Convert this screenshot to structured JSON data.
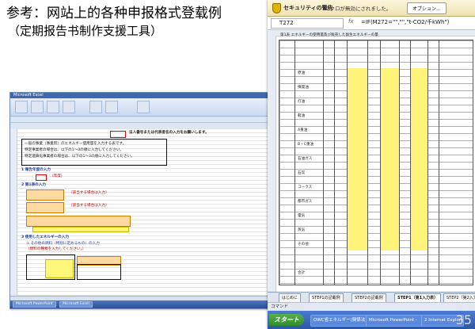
{
  "heading": {
    "line1": "参考：网站上的各种申报格式登载例",
    "line2": "（定期报告书制作支援工具）"
  },
  "left_window": {
    "sheet_notice": "法人番号または代表者名の入力をお願いします。",
    "section1": "1 報告年度の入力",
    "section2": "2 第1表の入力",
    "section3": "3 使用したエネルギーの入力",
    "section3a": "① その他の燃料（特別に定めるもの）の入力",
    "taskbar": [
      "Microsoft PowerPoint",
      "Microsoft Excel"
    ]
  },
  "right_window": {
    "security_title": "セキュリティの警告",
    "security_msg": "マクロが無効にされました。",
    "options_button": "オプション...",
    "name_box": "T272",
    "fx": "fx",
    "formula": "=IF(M272=\"\",\"\",\"t-CO2/千kWh\")",
    "sheet_title": "第1表 エネルギーの使用量及び販売した副生エネルギーの量",
    "row_labels": [
      "原油",
      "揮発油",
      "灯油",
      "軽油",
      "A重油",
      "B・C重油",
      "石油ガス",
      "石炭",
      "コークス",
      "都市ガス",
      "電気",
      "蒸気",
      "その他",
      "合計"
    ],
    "tabs": [
      "はじめに",
      "STEP1の記載例",
      "STEP2の記載例",
      "STEP1（第1入力表）",
      "STEP2（第2入力表）"
    ],
    "command_label": "コマンド",
    "start_label": "スタート",
    "task_items": [
      "OWC省エネルギー(関係法)",
      "Microsoft PowerPoint -",
      "2 Internet Explorer"
    ],
    "page_number": "35"
  }
}
